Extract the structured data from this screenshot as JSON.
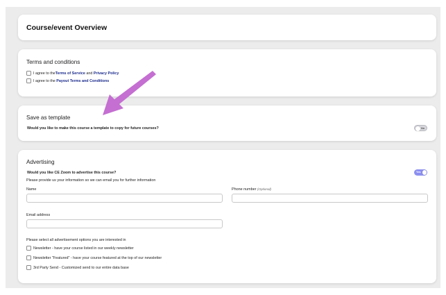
{
  "overview": {
    "title": "Course/event Overview"
  },
  "terms": {
    "title": "Terms and conditions",
    "items": [
      {
        "prefix": "I agree to the ",
        "link1": "Terms of Service",
        "middle": " and ",
        "link2": "Privacy Policy"
      },
      {
        "prefix": "I agree to the ",
        "link1": "Payout Terms and Conditions"
      }
    ]
  },
  "template": {
    "title": "Save as template",
    "question": "Would you like to make this course a template to copy for future courses?",
    "toggle_label": "No",
    "toggle_state": "off"
  },
  "advertising": {
    "title": "Advertising",
    "question": "Would you like CE Zoom to advertise this course?",
    "toggle_label": "Yes",
    "toggle_state": "on",
    "info": "Please provide us your information so we can email you for further information",
    "name_label": "Name",
    "phone_label": "Phone number",
    "phone_optional": "(Optional)",
    "email_label": "Email address",
    "options_intro": "Please select all advertisement options you are interested in",
    "options": [
      "Newsletter - have your course listed in our weekly newsletter",
      "Newsletter \"Featured\" - have your course featured at the top of our newsletter",
      "3rd Party Send - Customized send to our entire data base"
    ]
  },
  "colors": {
    "arrow": "#c46fd1",
    "link": "#1a2a8c",
    "toggle_on": "#8c8ff0",
    "background": "#ececec"
  },
  "icons": {
    "arrow": "pointer-arrow-icon"
  }
}
